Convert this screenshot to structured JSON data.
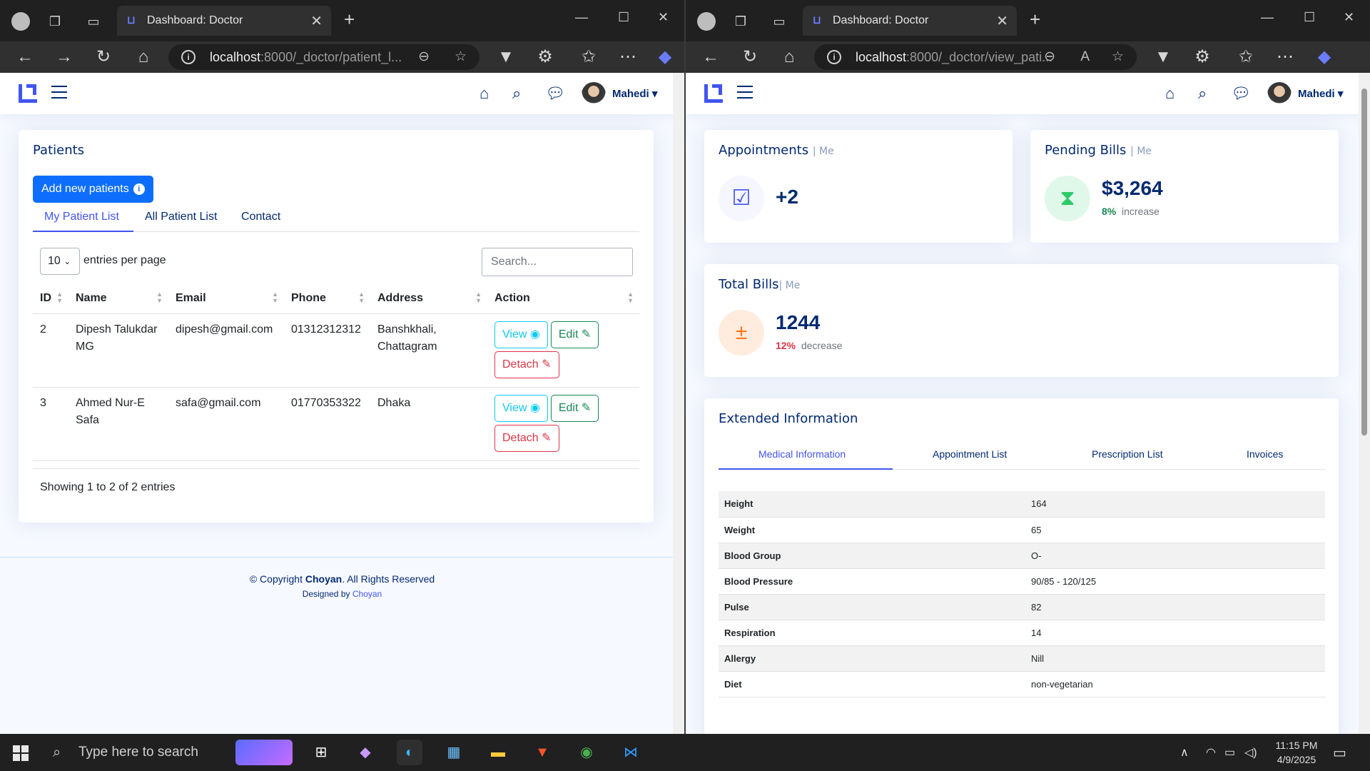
{
  "browser": {
    "tab_title": "Dashboard: Doctor",
    "tab_close": "✕",
    "left_url_host": "localhost",
    "left_url_path": ":8000/_doctor/patient_l...",
    "right_url_host": "localhost",
    "right_url_path": ":8000/_doctor/view_pati..."
  },
  "header": {
    "user_name": "Mahedi"
  },
  "patients": {
    "title": "Patients",
    "add_button": "Add new patients",
    "tabs": [
      "My Patient List",
      "All Patient List",
      "Contact"
    ],
    "entries_value": "10",
    "entries_label": "entries per page",
    "search_placeholder": "Search...",
    "columns": [
      "ID",
      "Name",
      "Email",
      "Phone",
      "Address",
      "Action"
    ],
    "rows": [
      {
        "id": "2",
        "name": "Dipesh Talukdar MG",
        "email": "dipesh@gmail.com",
        "phone": "01312312312",
        "address": "Banshkhali, Chattagram"
      },
      {
        "id": "3",
        "name": "Ahmed Nur-E Safa",
        "email": "safa@gmail.com",
        "phone": "01770353322",
        "address": "Dhaka"
      }
    ],
    "actions": {
      "view": "View",
      "edit": "Edit",
      "detach": "Detach"
    },
    "showing": "Showing 1 to 2 of 2 entries"
  },
  "footer": {
    "copyright_prefix": "© Copyright",
    "brand": "Choyan",
    "rights": ". All Rights Reserved",
    "designed_by": "Designed by",
    "designer": "Choyan"
  },
  "dashboard": {
    "appointments": {
      "title": "Appointments",
      "sub": "| Me",
      "value": "+2"
    },
    "pending_bills": {
      "title": "Pending Bills",
      "sub": "| Me",
      "value": "$3,264",
      "pct": "8%",
      "trend": "increase"
    },
    "total_bills": {
      "title": "Total Bills",
      "sub": "| Me",
      "value": "1244",
      "pct": "12%",
      "trend": "decrease"
    },
    "extended": {
      "title": "Extended Information",
      "tabs": [
        "Medical Information",
        "Appointment List",
        "Prescription List",
        "Invoices"
      ],
      "rows": [
        {
          "k": "Height",
          "v": "164"
        },
        {
          "k": "Weight",
          "v": "65"
        },
        {
          "k": "Blood Group",
          "v": "O-"
        },
        {
          "k": "Blood Pressure",
          "v": "90/85 - 120/125"
        },
        {
          "k": "Pulse",
          "v": "82"
        },
        {
          "k": "Respiration",
          "v": "14"
        },
        {
          "k": "Allergy",
          "v": "Nill"
        },
        {
          "k": "Diet",
          "v": "non-vegetarian"
        }
      ]
    }
  },
  "taskbar": {
    "search_placeholder": "Type here to search",
    "time": "11:15 PM",
    "date": "4/9/2025"
  },
  "colors": {
    "accent": "#4154f1",
    "primary": "#0d6efd",
    "heading": "#012970",
    "success": "#198754",
    "danger": "#dc3545",
    "info": "#0dcaf0"
  }
}
